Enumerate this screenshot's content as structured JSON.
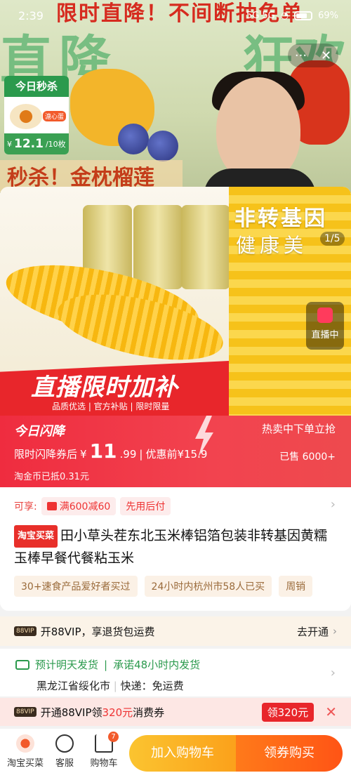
{
  "status_bar": {
    "time": "2:39",
    "signal": "5G 5G",
    "battery": "69%"
  },
  "live_background": {
    "banner_text": "限时直降！不间断抽免单",
    "big_text_left": "直降",
    "big_text_right": "狂欢",
    "seckill": {
      "title": "今日秒杀",
      "tag": "溏心蛋",
      "currency": "¥",
      "price": "12.1",
      "unit": "/10枚"
    },
    "bottom_banner": "秒杀！金枕榴莲",
    "controls": {
      "more": "···",
      "close": "✕"
    }
  },
  "carousel": {
    "main_title": "直播限时加补",
    "main_sub": "品质优选 | 官方补贴 | 限时限量",
    "side_title": "非转基因",
    "side_sub": "健康美",
    "pager": "1/5",
    "live_label": "直播中"
  },
  "flash": {
    "label": "今日闪降",
    "hot": "热卖中下单立抢",
    "price_prefix": "限时闪降券后",
    "currency": "¥",
    "price_int": "11",
    "price_dec": ".99",
    "separator": "|",
    "before_label": "优惠前¥15.9",
    "sold": "已售 6000+",
    "coin": "淘金币已抵0.31元"
  },
  "info": {
    "enjoy_label": "可享:",
    "coupon": "满600减60",
    "pay_later": "先用后付",
    "shop_tag": "淘宝买菜",
    "title": "田小草头茬东北玉米棒铝箔包装非转基因黄糯玉棒早餐代餐粘玉米",
    "chips": [
      "30+速食产品爱好者买过",
      "24小时内杭州市58人已买",
      "周销"
    ]
  },
  "vip": {
    "badge": "88VIP",
    "text": "开88VIP，享退货包运费",
    "go": "去开通"
  },
  "shipping": {
    "line1_a": "预计明天发货",
    "line1_sep": "|",
    "line1_b": "承诺48小时内发货",
    "origin": "黑龙江省绥化市",
    "line2_sep": "|",
    "delivery": "快递：免运费"
  },
  "coupon_strip": {
    "badge": "88VIP",
    "text_a": "开通88VIP领",
    "amount": "320元",
    "text_b": "消费券",
    "button": "领320元",
    "close": "✕"
  },
  "bottom_bar": {
    "shop": "淘宝买菜",
    "service": "客服",
    "cart": "购物车",
    "cart_count": "7",
    "add_cart": "加入购物车",
    "buy": "领券购买"
  },
  "colors": {
    "brand_red": "#e8262b",
    "orange": "#ff5415",
    "yellow": "#fbc430",
    "green": "#2b9a4d"
  }
}
